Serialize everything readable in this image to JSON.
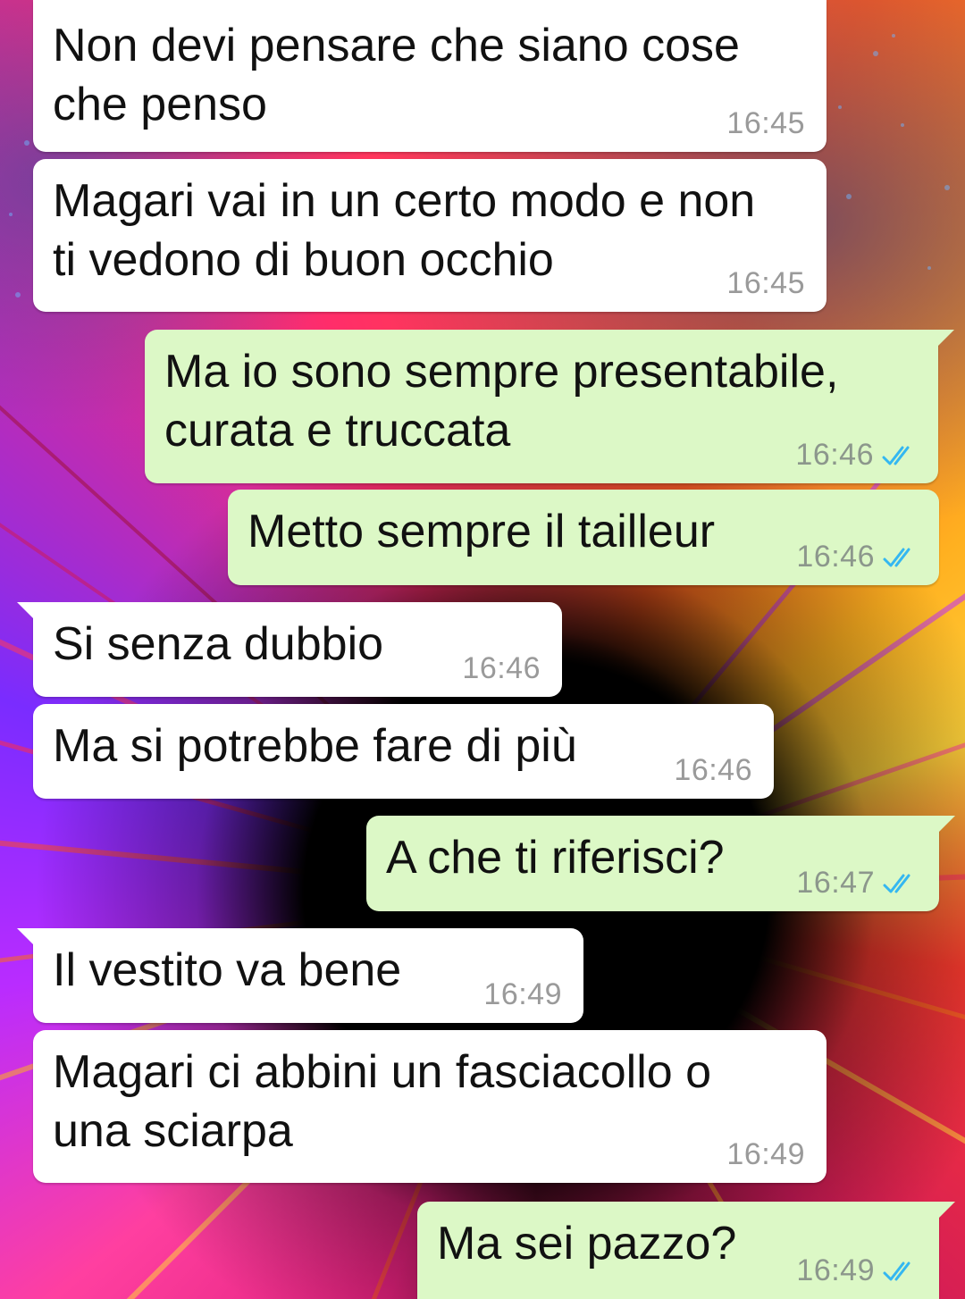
{
  "colors": {
    "incoming_bubble": "#ffffff",
    "outgoing_bubble": "#dcf8c6",
    "read_ticks": "#34b7f1",
    "timestamp": "#9a9a9a"
  },
  "messages": [
    {
      "direction": "incoming",
      "text": "Non devi pensare che siano cose\nche penso",
      "time": "16:45"
    },
    {
      "direction": "incoming",
      "text": "Magari vai in un certo modo e non\nti vedono di buon occhio",
      "time": "16:45"
    },
    {
      "direction": "outgoing",
      "text": "Ma io sono sempre presentabile,\ncurata e truccata",
      "time": "16:46",
      "status": "read-double-check-icon"
    },
    {
      "direction": "outgoing",
      "text": "Metto sempre il tailleur",
      "time": "16:46",
      "status": "read-double-check-icon"
    },
    {
      "direction": "incoming",
      "text": "Si senza dubbio",
      "time": "16:46"
    },
    {
      "direction": "incoming",
      "text": "Ma si potrebbe fare di più",
      "time": "16:46"
    },
    {
      "direction": "outgoing",
      "text": "A che ti riferisci?",
      "time": "16:47",
      "status": "read-double-check-icon"
    },
    {
      "direction": "incoming",
      "text": "Il vestito va bene",
      "time": "16:49"
    },
    {
      "direction": "incoming",
      "text": "Magari ci abbini un fasciacollo o\nuna sciarpa",
      "time": "16:49"
    },
    {
      "direction": "outgoing",
      "text": "Ma sei pazzo?",
      "time": "16:49",
      "status": "read-double-check-icon"
    }
  ]
}
